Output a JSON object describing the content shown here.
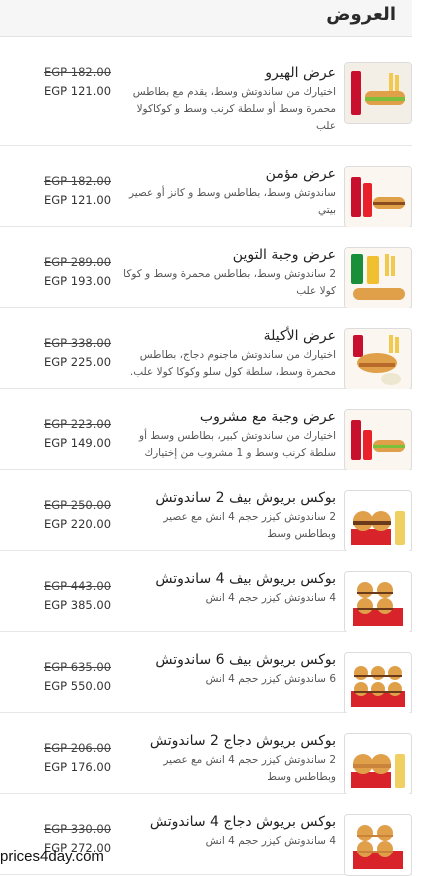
{
  "header": {
    "title": "العروض"
  },
  "items": [
    {
      "name": "عرض الهيرو",
      "desc": "اختيارك من ساندوتش وسط، يقدم مع بطاطس محمرة وسط أو سلطة كرنب وسط و كوكاكولا علب",
      "old_price": "EGP 182.00",
      "new_price": "EGP 121.00",
      "image": "combo-sandwich-fries-image"
    },
    {
      "name": "عرض مؤمن",
      "desc": "ساندوتش وسط، بطاطس وسط و كانز أو عصير بيتي",
      "old_price": "EGP 182.00",
      "new_price": "EGP 121.00",
      "image": "combo-sandwich-cans-image"
    },
    {
      "name": "عرض وجبة التوين",
      "desc": "2 ساندوتش وسط، بطاطس محمرة وسط و كوكا كولا علب",
      "old_price": "EGP 289.00",
      "new_price": "EGP 193.00",
      "image": "twin-meal-image"
    },
    {
      "name": "عرض الأكيلة",
      "desc": "اختيارك من ساندوتش ماجنوم دجاج، بطاطس محمرة وسط، سلطة كول سلو وكوكا كولا علب.",
      "old_price": "EGP 338.00",
      "new_price": "EGP 225.00",
      "image": "akela-meal-image"
    },
    {
      "name": "عرض وجبة مع مشروب",
      "desc": "اختيارك من ساندوتش كبير، بطاطس وسط أو سلطة كرنب وسط و 1 مشروب من إختيارك",
      "old_price": "EGP 223.00",
      "new_price": "EGP 149.00",
      "image": "meal-with-drink-image"
    },
    {
      "name": "بوكس بريوش بيف 2 ساندوتش",
      "desc": "2 ساندوتش كيزر حجم 4 انش مع عصير وبطاطس وسط",
      "old_price": "EGP 250.00",
      "new_price": "EGP 220.00",
      "image": "beef-brioche-box-2-image"
    },
    {
      "name": "بوكس بريوش بيف 4 ساندوتش",
      "desc": "4 ساندوتش كيزر حجم 4 انش",
      "old_price": "EGP 443.00",
      "new_price": "EGP 385.00",
      "image": "beef-brioche-box-4-image"
    },
    {
      "name": "بوكس بريوش بيف 6 ساندوتش",
      "desc": "6 ساندوتش كيزر حجم 4 انش",
      "old_price": "EGP 635.00",
      "new_price": "EGP 550.00",
      "image": "beef-brioche-box-6-image"
    },
    {
      "name": "بوكس بريوش دجاج 2 ساندوتش",
      "desc": "2 ساندوتش كيزر حجم 4 انش مع عصير وبطاطس وسط",
      "old_price": "EGP 206.00",
      "new_price": "EGP 176.00",
      "image": "chicken-brioche-box-2-image"
    },
    {
      "name": "بوكس بريوش دجاج 4 ساندوتش",
      "desc": "4 ساندوتش كيزر حجم 4 انش",
      "old_price": "EGP 330.00",
      "new_price": "EGP 272.00",
      "image": "chicken-brioche-box-4-image"
    }
  ],
  "watermark": "prices4day.com",
  "colors": {
    "header_bg": "#f6f6f6",
    "divider": "#e6e6e6",
    "box_red": "#d8232a",
    "bun": "#e0a04a"
  }
}
